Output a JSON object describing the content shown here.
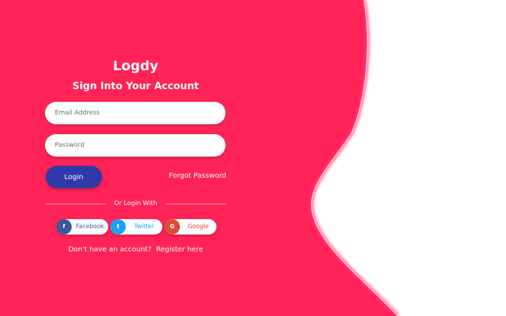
{
  "brand": {
    "name": "Logdy"
  },
  "form": {
    "title": "Sign Into Your Account",
    "email_placeholder": "Email Address",
    "password_placeholder": "Password",
    "login_label": "Login",
    "forgot_label": "Forgot Password"
  },
  "social": {
    "divider_label": "Or Login With",
    "buttons": [
      {
        "label": "Facebook",
        "icon": "f",
        "icon_name": "facebook-icon",
        "color": "#3b5998"
      },
      {
        "label": "Twitter",
        "icon": "t",
        "icon_name": "twitter-icon",
        "color": "#1da1f2"
      },
      {
        "label": "Google",
        "icon": "G",
        "icon_name": "google-icon",
        "color": "#dd4b39"
      }
    ]
  },
  "register": {
    "prompt": "Don't have an account?",
    "link_label": "Register here"
  },
  "colors": {
    "accent": "#ff2357",
    "button": "#2f3aa8",
    "background": "#ffffff"
  }
}
